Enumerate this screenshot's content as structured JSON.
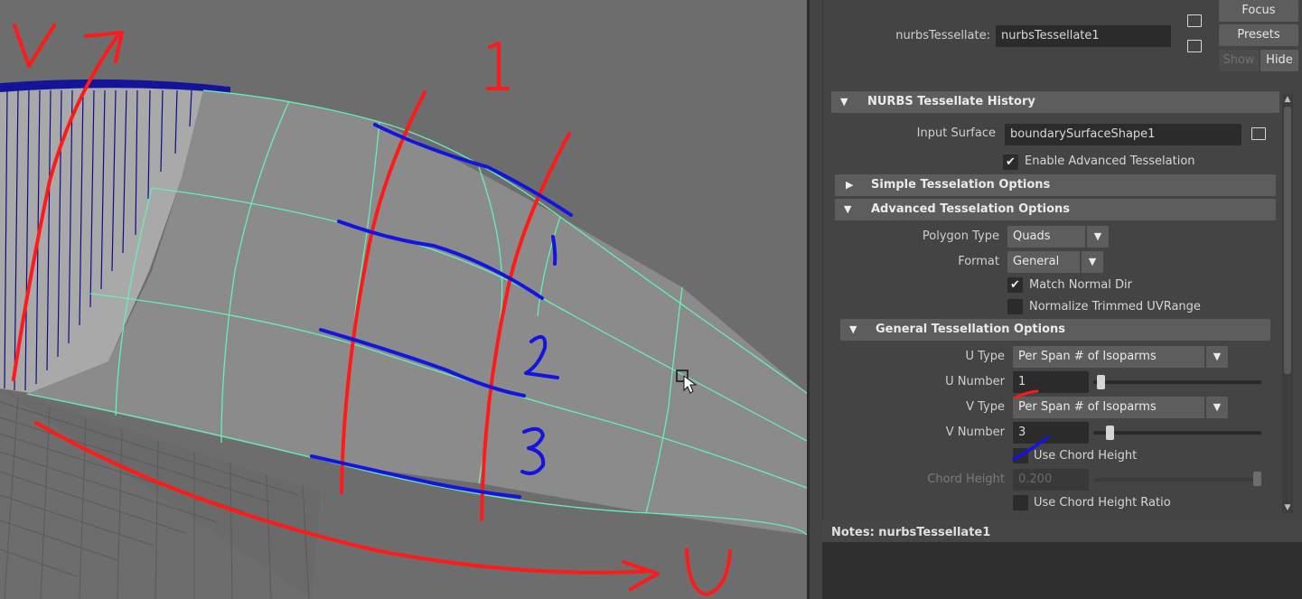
{
  "viewport": {
    "annotations": {
      "v_label": "V",
      "u_label": "U",
      "column_number": "1",
      "row_numbers": [
        "1",
        "2",
        "3"
      ]
    },
    "colors": {
      "red_annotation": "#ff1a1a",
      "blue_annotation": "#1414e0",
      "isoparm_lines": "#66f0b4",
      "surface": "#8a8a8a",
      "cylinder_wire": "#0d0d8a"
    }
  },
  "attribute_editor": {
    "node_label": "nurbsTessellate:",
    "node_value": "nurbsTessellate1",
    "buttons": {
      "focus": "Focus",
      "presets": "Presets",
      "show": "Show",
      "hide": "Hide"
    },
    "history_section": "NURBS Tessellate History",
    "input_surface_label": "Input Surface",
    "input_surface_value": "boundarySurfaceShape1",
    "enable_advanced_label": "Enable Advanced Tesselation",
    "enable_advanced_checked": true,
    "simple_section": "Simple Tesselation Options",
    "advanced_section": "Advanced Tesselation Options",
    "polygon_type_label": "Polygon Type",
    "polygon_type_value": "Quads",
    "format_label": "Format",
    "format_value": "General",
    "match_normal_label": "Match Normal Dir",
    "match_normal_checked": true,
    "normalize_label": "Normalize Trimmed UVRange",
    "normalize_checked": false,
    "general_section": "General Tessellation Options",
    "u_type_label": "U Type",
    "u_type_value": "Per Span # of Isoparms",
    "u_number_label": "U Number",
    "u_number_value": "1",
    "v_type_label": "V Type",
    "v_type_value": "Per Span # of Isoparms",
    "v_number_label": "V Number",
    "v_number_value": "3",
    "use_chord_label": "Use Chord Height",
    "use_chord_checked": false,
    "chord_height_label": "Chord Height",
    "chord_height_value": "0.200",
    "use_chord_ratio_label": "Use Chord Height Ratio",
    "use_chord_ratio_checked": false,
    "notes_label": "Notes:  nurbsTessellate1"
  }
}
